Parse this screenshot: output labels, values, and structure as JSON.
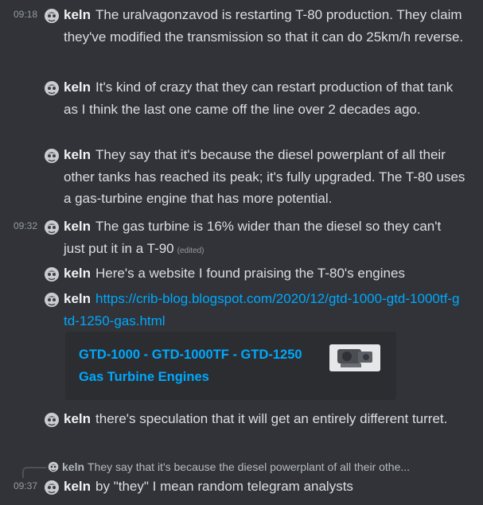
{
  "messages": [
    {
      "time": "09:18",
      "author": "keln",
      "text": "The uralvagonzavod is restarting T-80 production. They claim they've modified the transmission so that it can do 25km/h reverse."
    },
    {
      "time": "",
      "author": "keln",
      "text": "It's kind of crazy that they can restart production of that tank as I think the last one came off the line over 2 decades ago."
    },
    {
      "time": "",
      "author": "keln",
      "text": "They say that it's because the diesel powerplant of all their other tanks has reached its peak; it's fully upgraded. The T-80 uses a gas-turbine engine that has more potential."
    },
    {
      "time": "09:32",
      "author": "keln",
      "text": "The gas turbine is 16% wider than the diesel so they can't just put it in a T-90",
      "edited": "(edited)"
    },
    {
      "time": "",
      "author": "keln",
      "text": "Here's a website I found praising the T-80's engines"
    },
    {
      "time": "",
      "author": "keln",
      "link": "https://crib-blog.blogspot.com/2020/12/gtd-1000-gtd-1000tf-gtd-1250-gas.html"
    },
    {
      "time": "",
      "author": "keln",
      "text": "there's speculation that it will get an entirely different turret."
    },
    {
      "time": "09:37",
      "author": "keln",
      "text": "by \"they\" I mean random telegram analysts"
    }
  ],
  "embed": {
    "title": "GTD-1000 - GTD-1000TF - GTD-1250 Gas Turbine Engines"
  },
  "reply": {
    "author": "keln",
    "text": "They say that it's because the diesel powerplant of all their othe..."
  },
  "colors": {
    "background": "#313338",
    "link": "#00a8fc",
    "timestamp": "#949ba4"
  }
}
